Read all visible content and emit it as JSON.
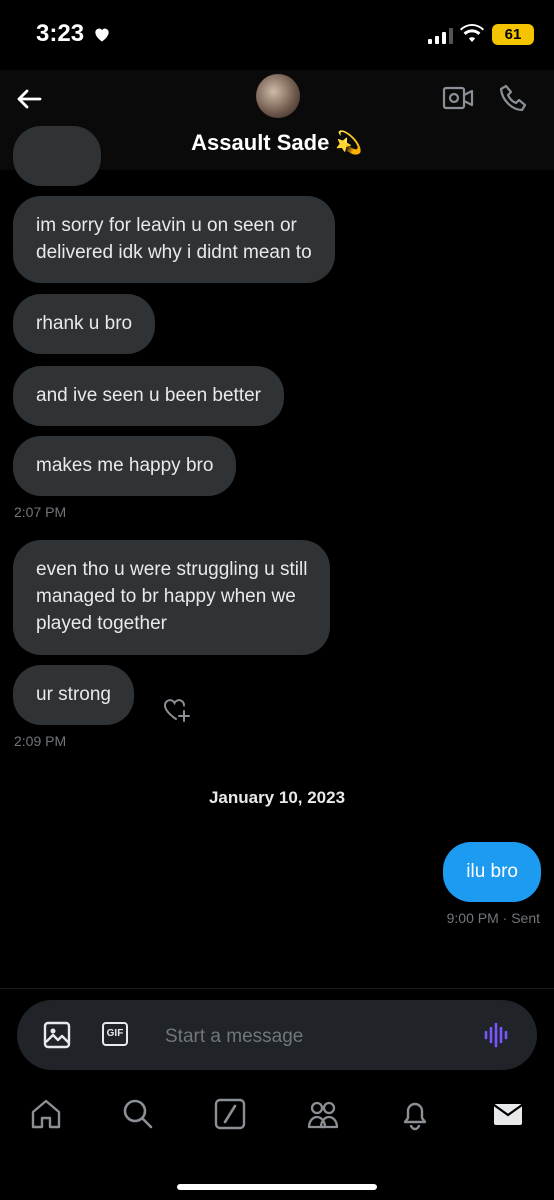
{
  "status_bar": {
    "time": "3:23",
    "battery": "61"
  },
  "header": {
    "contact_name": "Assault Sade 💫"
  },
  "messages": [
    {
      "text": "im sorry for leavin u on seen or\ndelivered idk why i didnt mean to"
    },
    {
      "text": "rhank u bro"
    },
    {
      "text": "and ive seen u been better"
    },
    {
      "text": "makes me happy bro"
    },
    {
      "text": "even tho u were struggling u still\nmanaged to br happy when we\nplayed together"
    },
    {
      "text": "ur strong"
    }
  ],
  "timestamps": [
    "2:07 PM",
    "2:09 PM"
  ],
  "date_separator": "January 10, 2023",
  "outgoing": {
    "text": "ilu bro",
    "time": "9:00 PM",
    "status": "· Sent"
  },
  "composer": {
    "placeholder": "Start a message",
    "gif_label": "GIF"
  },
  "colors": {
    "incoming_bubble": "#2f3336",
    "outgoing_bubble": "#1d9bf0",
    "voice_accent": "#7856ff"
  },
  "tabs": [
    "home-icon",
    "search-icon",
    "grok-icon",
    "communities-icon",
    "notifications-icon",
    "messages-icon"
  ]
}
